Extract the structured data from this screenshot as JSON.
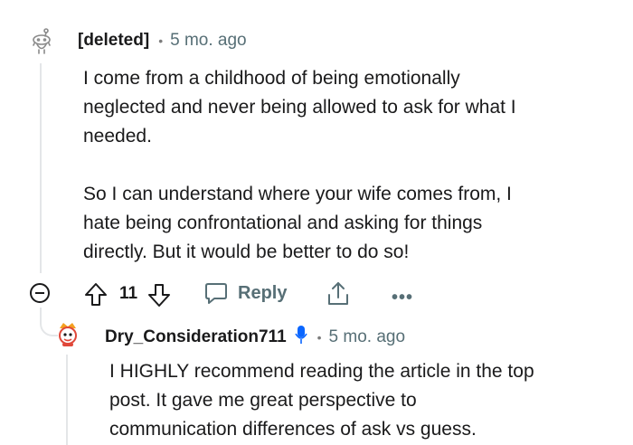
{
  "comment": {
    "author": "[deleted]",
    "time": "5 mo. ago",
    "paragraphs": [
      [
        "I come from a childhood of being emotionally",
        "neglected and never being allowed to ask for what I",
        "needed."
      ],
      [
        "So I can understand where your wife comes from, I",
        "hate being confrontational and asking for things",
        "directly. But it would be better to do so!"
      ]
    ],
    "actions": {
      "score": "11",
      "reply_label": "Reply",
      "more_label": "•••"
    }
  },
  "reply": {
    "author": "Dry_Consideration711",
    "time": "5 mo. ago",
    "lines": [
      "I HIGHLY recommend reading the article in the top",
      "post. It gave me great perspective to",
      "communication differences of ask vs guess."
    ]
  },
  "colors": {
    "text": "#1a1a1b",
    "meta": "#576f76",
    "thread_line": "#e4e6e8",
    "mic": "#0a66ff"
  },
  "icons": {
    "deleted_avatar": "snoo-outline-icon",
    "upvote": "arrow-up-icon",
    "downvote": "arrow-down-icon",
    "reply": "speech-bubble-icon",
    "share": "share-icon",
    "collapse": "minus-circle-icon",
    "mic": "microphone-icon"
  }
}
